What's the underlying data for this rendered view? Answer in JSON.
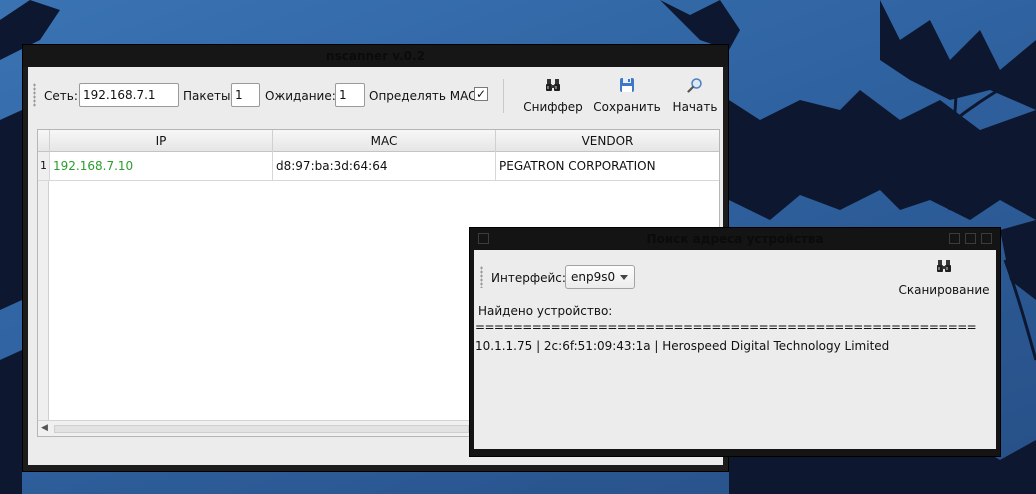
{
  "main_window": {
    "title": "nscanner v.0.2",
    "toolbar": {
      "network_label": "Сеть:",
      "network_value": "192.168.7.1",
      "packets_label": "Пакеты:",
      "packets_value": "1",
      "wait_label": "Ожидание:",
      "wait_value": "1",
      "mac_label": "Определять MAC:",
      "mac_checked": "✓",
      "sniffer_label": "Сниффер",
      "sniffer_icon": "binoculars-icon",
      "save_label": "Сохранить",
      "save_icon": "floppy-disk-icon",
      "start_label": "Начать",
      "start_icon": "magnifier-icon"
    },
    "table": {
      "columns": [
        "IP",
        "MAC",
        "VENDOR"
      ],
      "rows": [
        {
          "num": "1",
          "ip": "192.168.7.10",
          "mac": "d8:97:ba:3d:64:64",
          "vendor": "PEGATRON CORPORATION"
        }
      ],
      "ip_color": "#2a9d2a"
    }
  },
  "dialog": {
    "title": "Поиск адреса устройства",
    "interface_label": "Интерфейс:",
    "interface_value": "enp9s0",
    "scan_label": "Сканирование",
    "scan_icon": "binoculars-icon",
    "log": {
      "found": "Найдено устройство:",
      "separator": "=====================================================",
      "result": "10.1.1.75 | 2c:6f:51:09:43:1a | Herospeed Digital Technology Limited"
    }
  }
}
